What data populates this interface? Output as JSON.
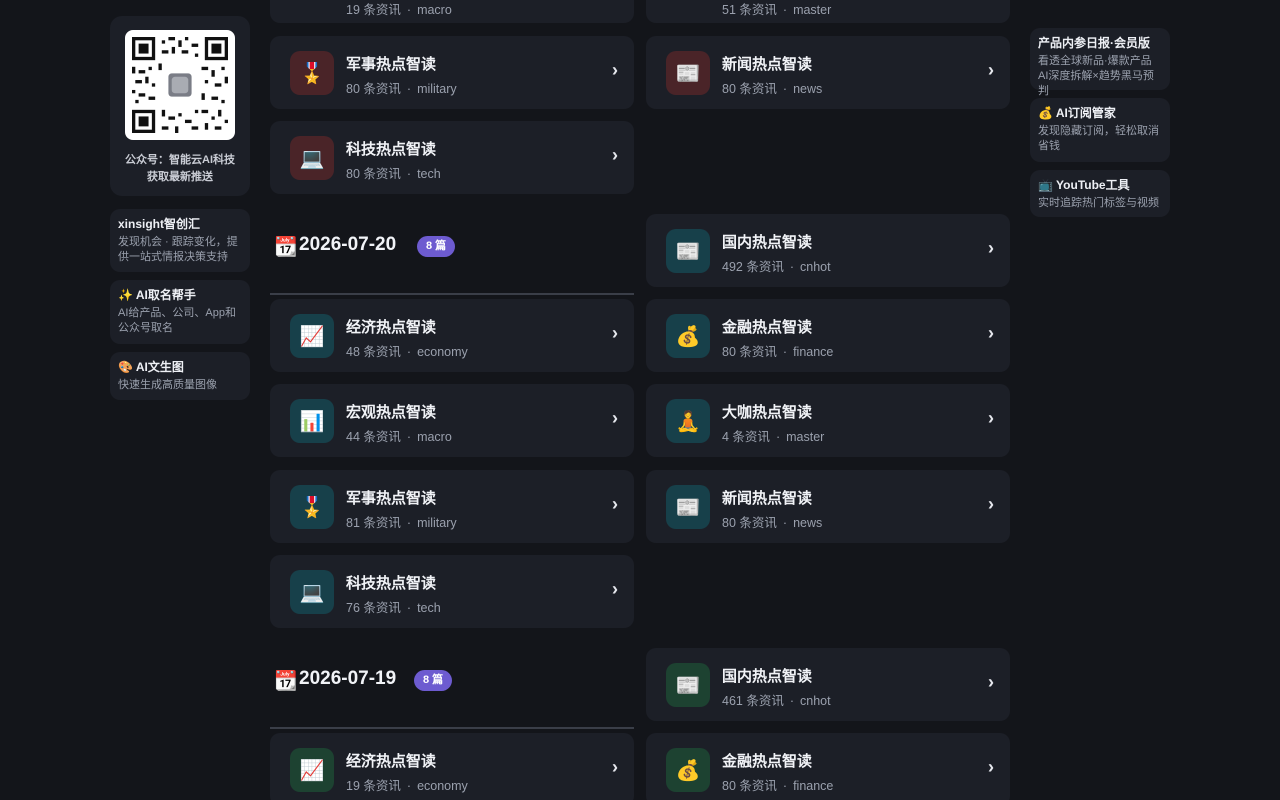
{
  "left_sidebar": {
    "qr_caption_line1": "公众号：智能云AI科技",
    "qr_caption_line2": "获取最新推送",
    "cards": [
      {
        "title": "xinsight智创汇",
        "desc": "发现机会 · 跟踪变化，提供一站式情报决策支持"
      },
      {
        "title": "✨ AI取名帮手",
        "desc": "AI给产品、公司、App和公众号取名"
      },
      {
        "title": "🎨 AI文生图",
        "desc": "快速生成高质量图像"
      }
    ]
  },
  "right_sidebar": {
    "cards": [
      {
        "title": "产品内参日报·会员版",
        "desc": "看透全球新品·爆款产品AI深度拆解×趋势黑马预判"
      },
      {
        "title": "💰 AI订阅管家",
        "desc": "发现隐藏订阅，轻松取消省钱"
      },
      {
        "title": "📺 YouTube工具",
        "desc": "实时追踪热门标签与视频"
      }
    ]
  },
  "top_partial": {
    "left": {
      "meta_count": "19 条资讯",
      "meta_tag": "macro"
    },
    "right": {
      "meta_count": "51 条资讯",
      "meta_tag": "master"
    }
  },
  "section_prev": {
    "cards": [
      {
        "icon": "🎖️",
        "title": "军事热点智读",
        "count": "80 条资讯",
        "tag": "military"
      },
      {
        "icon": "📰",
        "title": "新闻热点智读",
        "count": "80 条资讯",
        "tag": "news"
      },
      {
        "icon": "💻",
        "title": "科技热点智读",
        "count": "80 条资讯",
        "tag": "tech"
      }
    ]
  },
  "section_0720": {
    "calendar_icon": "📆",
    "date": "2026-07-20",
    "badge": "8 篇",
    "cards": [
      {
        "icon": "📰",
        "title": "国内热点智读",
        "count": "492 条资讯",
        "tag": "cnhot"
      },
      {
        "icon": "📈",
        "title": "经济热点智读",
        "count": "48 条资讯",
        "tag": "economy"
      },
      {
        "icon": "💰",
        "title": "金融热点智读",
        "count": "80 条资讯",
        "tag": "finance"
      },
      {
        "icon": "📊",
        "title": "宏观热点智读",
        "count": "44 条资讯",
        "tag": "macro"
      },
      {
        "icon": "🧘",
        "title": "大咖热点智读",
        "count": "4 条资讯",
        "tag": "master"
      },
      {
        "icon": "🎖️",
        "title": "军事热点智读",
        "count": "81 条资讯",
        "tag": "military"
      },
      {
        "icon": "📰",
        "title": "新闻热点智读",
        "count": "80 条资讯",
        "tag": "news"
      },
      {
        "icon": "💻",
        "title": "科技热点智读",
        "count": "76 条资讯",
        "tag": "tech"
      }
    ]
  },
  "section_0719": {
    "calendar_icon": "📆",
    "date": "2026-07-19",
    "badge": "8 篇",
    "cards": [
      {
        "icon": "📰",
        "title": "国内热点智读",
        "count": "461 条资讯",
        "tag": "cnhot"
      },
      {
        "icon": "📈",
        "title": "经济热点智读",
        "count": "19 条资讯",
        "tag": "economy"
      },
      {
        "icon": "💰",
        "title": "金融热点智读",
        "count": "80 条资讯",
        "tag": "finance"
      }
    ]
  },
  "ui": {
    "arrow": "›",
    "dot": "·"
  }
}
